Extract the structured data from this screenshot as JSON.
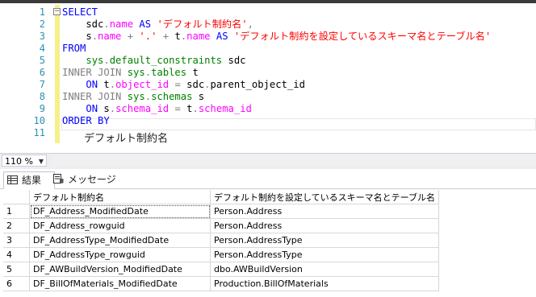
{
  "editor": {
    "lines": [
      {
        "n": "1",
        "parts": [
          [
            "kw",
            "SELECT"
          ]
        ]
      },
      {
        "n": "2",
        "parts": [
          [
            "plain",
            "    sdc"
          ],
          [
            "gray",
            "."
          ],
          [
            "fn",
            "name"
          ],
          [
            "plain",
            " "
          ],
          [
            "kw",
            "AS"
          ],
          [
            "plain",
            " "
          ],
          [
            "str",
            "'デフォルト制約名'"
          ],
          [
            "gray",
            ","
          ]
        ]
      },
      {
        "n": "3",
        "parts": [
          [
            "plain",
            "    s"
          ],
          [
            "gray",
            "."
          ],
          [
            "fn",
            "name"
          ],
          [
            "plain",
            " "
          ],
          [
            "gray",
            "+"
          ],
          [
            "plain",
            " "
          ],
          [
            "str",
            "'.'"
          ],
          [
            "plain",
            " "
          ],
          [
            "gray",
            "+"
          ],
          [
            "plain",
            " t"
          ],
          [
            "gray",
            "."
          ],
          [
            "fn",
            "name"
          ],
          [
            "plain",
            " "
          ],
          [
            "kw",
            "AS"
          ],
          [
            "plain",
            " "
          ],
          [
            "str",
            "'デフォルト制約を設定しているスキーマ名とテーブル名'"
          ]
        ]
      },
      {
        "n": "4",
        "parts": [
          [
            "kw",
            "FROM"
          ]
        ]
      },
      {
        "n": "5",
        "parts": [
          [
            "plain",
            "    "
          ],
          [
            "sys",
            "sys"
          ],
          [
            "gray",
            "."
          ],
          [
            "sys",
            "default_constraints"
          ],
          [
            "plain",
            " sdc"
          ]
        ]
      },
      {
        "n": "6",
        "parts": [
          [
            "gray",
            "INNER JOIN"
          ],
          [
            "plain",
            " "
          ],
          [
            "sys",
            "sys"
          ],
          [
            "gray",
            "."
          ],
          [
            "sys",
            "tables"
          ],
          [
            "plain",
            " t"
          ]
        ]
      },
      {
        "n": "7",
        "parts": [
          [
            "plain",
            "    "
          ],
          [
            "kw",
            "ON"
          ],
          [
            "plain",
            " t"
          ],
          [
            "gray",
            "."
          ],
          [
            "fn",
            "object_id"
          ],
          [
            "plain",
            " "
          ],
          [
            "gray",
            "="
          ],
          [
            "plain",
            " sdc"
          ],
          [
            "gray",
            "."
          ],
          [
            "plain",
            "parent_object_id"
          ]
        ]
      },
      {
        "n": "8",
        "parts": [
          [
            "gray",
            "INNER JOIN"
          ],
          [
            "plain",
            " "
          ],
          [
            "sys",
            "sys"
          ],
          [
            "gray",
            "."
          ],
          [
            "sys",
            "schemas"
          ],
          [
            "plain",
            " s"
          ]
        ]
      },
      {
        "n": "9",
        "parts": [
          [
            "plain",
            "    "
          ],
          [
            "kw",
            "ON"
          ],
          [
            "plain",
            " s"
          ],
          [
            "gray",
            "."
          ],
          [
            "fn",
            "schema_id"
          ],
          [
            "plain",
            " "
          ],
          [
            "gray",
            "="
          ],
          [
            "plain",
            " t"
          ],
          [
            "gray",
            "."
          ],
          [
            "fn",
            "schema_id"
          ]
        ]
      },
      {
        "n": "10",
        "parts": [
          [
            "kw",
            "ORDER BY"
          ]
        ]
      },
      {
        "n": "11",
        "parts": []
      }
    ],
    "autocomplete_text": "デフォルト制約名"
  },
  "zoom": {
    "value": "110 %"
  },
  "tabs": [
    {
      "label": "結果",
      "icon": "grid-icon"
    },
    {
      "label": "メッセージ",
      "icon": "message-icon"
    }
  ],
  "results": {
    "columns": [
      "デフォルト制約名",
      "デフォルト制約を設定しているスキーマ名とテーブル名"
    ],
    "rows": [
      {
        "n": "1",
        "c1": "DF_Address_ModifiedDate",
        "c2": "Person.Address"
      },
      {
        "n": "2",
        "c1": "DF_Address_rowguid",
        "c2": "Person.Address"
      },
      {
        "n": "3",
        "c1": "DF_AddressType_ModifiedDate",
        "c2": "Person.AddressType"
      },
      {
        "n": "4",
        "c1": "DF_AddressType_rowguid",
        "c2": "Person.AddressType"
      },
      {
        "n": "5",
        "c1": "DF_AWBuildVersion_ModifiedDate",
        "c2": "dbo.AWBuildVersion"
      },
      {
        "n": "6",
        "c1": "DF_BillOfMaterials_ModifiedDate",
        "c2": "Production.BillOfMaterials"
      }
    ]
  }
}
